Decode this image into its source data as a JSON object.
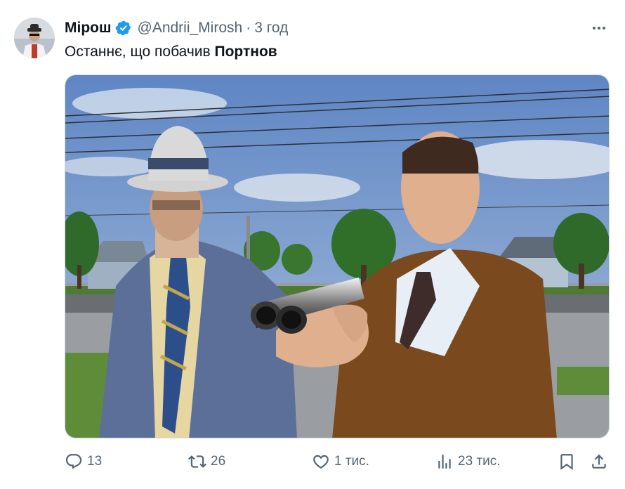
{
  "tweet": {
    "author_name": "Мірош",
    "handle": "@Andrii_Mirosh",
    "separator": "·",
    "time": "3 год",
    "text_regular": "Останнє, що побачив ",
    "text_bold": "Портнов"
  },
  "actions": {
    "replies": "13",
    "reposts": "26",
    "likes": "1 тис.",
    "views": "23 тис."
  },
  "colors": {
    "verified_badge": "#1d9bf0",
    "muted_text": "#536471",
    "primary_text": "#0f1419"
  },
  "icons": [
    "verified-badge-icon",
    "more-icon",
    "reply-icon",
    "repost-icon",
    "like-icon",
    "views-icon",
    "bookmark-icon",
    "share-icon"
  ]
}
